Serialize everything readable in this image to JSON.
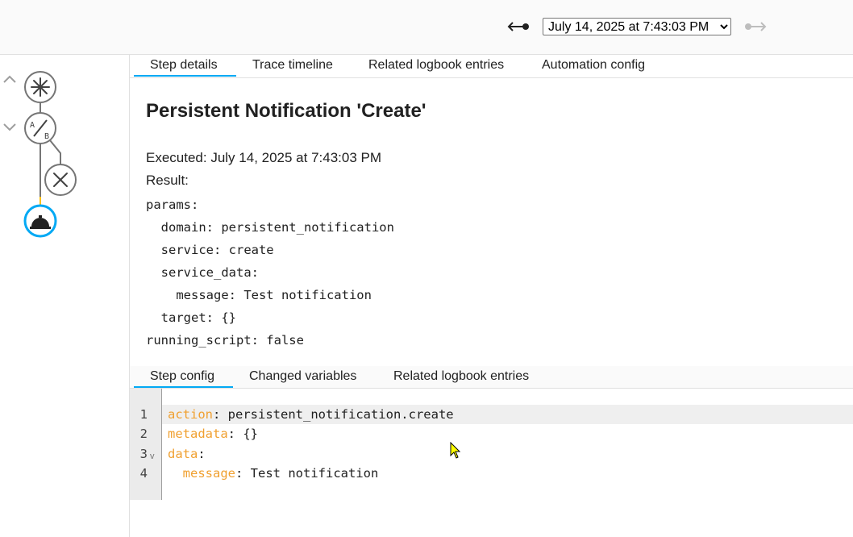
{
  "header": {
    "selected_run": "July 14, 2025 at 7:43:03 PM",
    "prev_icon": "arrow-left-end-icon",
    "next_icon": "arrow-right-end-icon"
  },
  "graph": {
    "nodes": [
      {
        "name": "trigger",
        "icon": "asterisk-icon"
      },
      {
        "name": "condition",
        "icon": "a-b-split-icon"
      },
      {
        "name": "branch-end",
        "icon": "close-circle-icon"
      },
      {
        "name": "action",
        "icon": "bell-service-icon",
        "selected": true
      }
    ]
  },
  "tabs": [
    {
      "label": "Step details",
      "active": true
    },
    {
      "label": "Trace timeline"
    },
    {
      "label": "Related logbook entries"
    },
    {
      "label": "Automation config"
    }
  ],
  "step": {
    "title": "Persistent Notification 'Create'",
    "executed": "Executed: July 14, 2025 at 7:43:03 PM",
    "result_label": "Result:",
    "result_yaml": [
      "params:",
      "  domain: persistent_notification",
      "  service: create",
      "  service_data:",
      "    message: Test notification",
      "  target: {}",
      "running_script: false"
    ]
  },
  "tabs2": [
    {
      "label": "Step config",
      "active": true
    },
    {
      "label": "Changed variables"
    },
    {
      "label": "Related logbook entries"
    }
  ],
  "editor": {
    "lines": [
      {
        "num": "1",
        "key": "action",
        "value": " persistent_notification.create",
        "indent": ""
      },
      {
        "num": "2",
        "key": "metadata",
        "value": " {}",
        "indent": ""
      },
      {
        "num": "3",
        "key": "data",
        "value": "",
        "indent": ""
      },
      {
        "num": "4",
        "key": "message",
        "value": " Test notification",
        "indent": "  "
      }
    ],
    "fold_marker": "v"
  },
  "colors": {
    "accent": "#03a9f4",
    "yaml_key": "#f0a030",
    "node_stroke": "#757575",
    "active_path": "#ffc107"
  }
}
